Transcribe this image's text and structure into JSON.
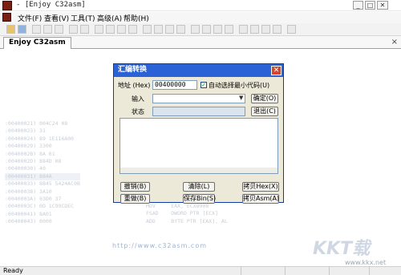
{
  "window": {
    "title": "- [Enjoy C32asm]",
    "minimize": "_",
    "maximize": "□",
    "close": "✕"
  },
  "menu": [
    "文件(F)",
    "查看(V)",
    "工具(T)",
    "高级(A)",
    "帮助(H)"
  ],
  "tab": {
    "label": "Enjoy C32asm",
    "close": "×"
  },
  "listing": [
    ":00400021) 004C24 08",
    ":00400023) 31",
    ":00400024) 89 1E116A00",
    ":00400029) 3300",
    ":0040002B) 8A 01",
    ":0040002D) 884D 08",
    ":00400030) 40",
    ":00400031) 884A",
    ":00400033) 8B45 5424AC0B",
    ":00400038) 3A10",
    ":0040003A) 03D0 37",
    ":0040003C) 0D 1C99CDEC",
    ":00400041) 8A01",
    ":00400043) 0000"
  ],
  "side_info": "MOV     EAX, ECX8908\nFSAD    DWORD PTR [ECX]\nADD     BYTE PTR [EAX], AL",
  "banner": "http://www.c32asm.com",
  "watermark": {
    "logo": "KKT载",
    "url": "www.kkx.net"
  },
  "status": "Ready",
  "dialog": {
    "title": "汇编转换",
    "close": "✕",
    "address_label": "地址 (Hex)",
    "address_value": "00400000",
    "auto_checkbox_label": "自动选择最小代码(U)",
    "input_label": "输入",
    "input_value": "",
    "confirm_button": "确定(O)",
    "status_label": "状态",
    "exit_button": "退出(C)",
    "buttons": {
      "undo": "撤销(B)",
      "clear": "清除(L)",
      "copy_hex": "拷贝Hex(X)",
      "redo": "重做(B)",
      "save_bin": "保存Bin(S)",
      "copy_asm": "拷贝Asm(A)"
    }
  }
}
